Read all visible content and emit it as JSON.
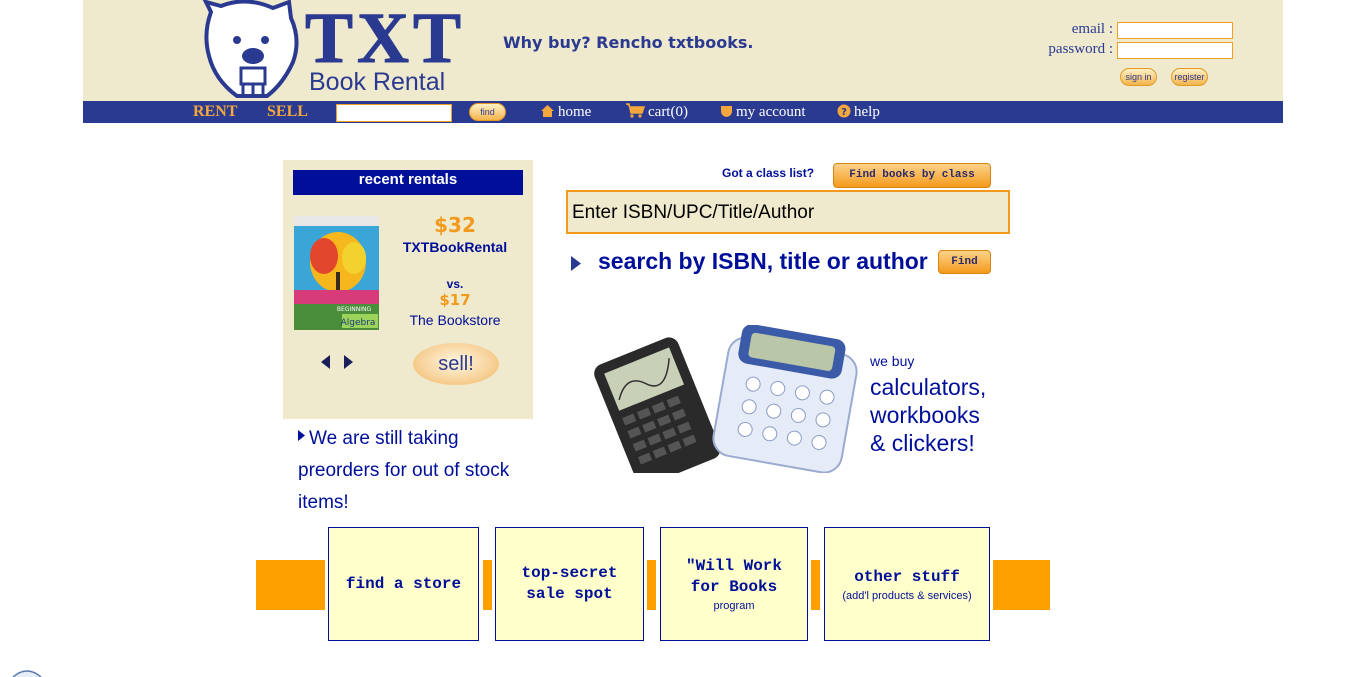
{
  "header": {
    "logo_main": "TXT",
    "logo_sub": "Book Rental",
    "tagline": "Why buy? Rencho txtbooks.",
    "email_label": "email :",
    "password_label": "password :",
    "signin_label": "sign in",
    "register_label": "register"
  },
  "nav": {
    "rent": "RENT",
    "sell": "SELL",
    "find": "find",
    "home": "home",
    "cart": "cart(0)",
    "account": "my account",
    "help": "help"
  },
  "rentals": {
    "title": "recent rentals",
    "our_price": "$32",
    "our_name": "TXTBookRental",
    "vs": "vs.",
    "their_price": "$17",
    "their_name": "The Bookstore",
    "sell_label": "sell!",
    "book_title": "Algebra",
    "book_subtitle": "BEGINNING"
  },
  "preorder": {
    "text": "We are still taking preorders for out of stock items!"
  },
  "search": {
    "classlist_label": "Got a class list?",
    "class_button": "Find books by class",
    "placeholder": "Enter ISBN/UPC/Title/Author",
    "label": "search by ISBN, title or author",
    "find_button": "Find"
  },
  "promo": {
    "we_buy": "we buy",
    "line1": "calculators,",
    "line2": "workbooks",
    "line3": "& clickers!"
  },
  "tiles": [
    {
      "title": "find a store",
      "sub": ""
    },
    {
      "title": "top-secret sale spot",
      "sub": ""
    },
    {
      "title": "\"Will Work for Books",
      "sub": "program"
    },
    {
      "title": "other stuff",
      "sub": "(add'l products & services)"
    }
  ],
  "colors": {
    "navy": "#2b3a91",
    "accent_orange": "#ff9f00",
    "beige": "#efe9cd"
  }
}
